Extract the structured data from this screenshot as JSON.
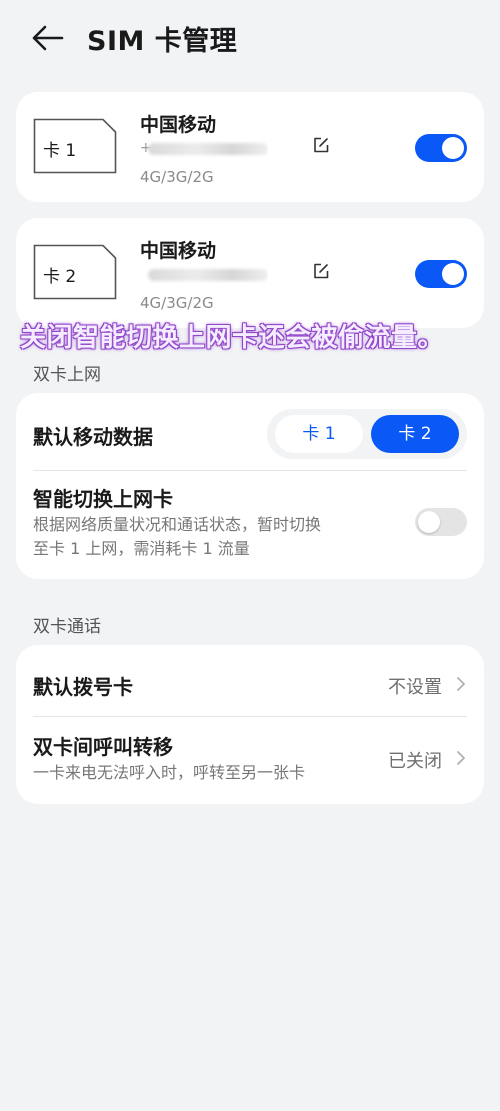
{
  "header": {
    "title": "SIM 卡管理",
    "back_icon": "back-arrow-icon"
  },
  "sim_cards": [
    {
      "label": "卡 1",
      "carrier": "中国移动",
      "number_prefix": "+",
      "network": "4G/3G/2G",
      "enabled": true
    },
    {
      "label": "卡 2",
      "carrier": "中国移动",
      "number_prefix": "",
      "network": "4G/3G/2G",
      "enabled": true
    }
  ],
  "overlay": {
    "text": "关闭智能切换上网卡还会被偷流量。"
  },
  "data_section": {
    "label": "双卡上网",
    "default_data": {
      "title": "默认移动数据",
      "options": [
        "卡 1",
        "卡 2"
      ],
      "selected": "卡 2"
    },
    "smart_switch": {
      "title": "智能切换上网卡",
      "subtitle_line1": "根据网络质量状况和通话状态，暂时切换",
      "subtitle_line2": "至卡 1 上网，需消耗卡 1 流量",
      "enabled": false
    }
  },
  "call_section": {
    "label": "双卡通话",
    "default_dial": {
      "title": "默认拨号卡",
      "value": "不设置"
    },
    "forwarding": {
      "title": "双卡间呼叫转移",
      "subtitle": "一卡来电无法呼入时，呼转至另一张卡",
      "value": "已关闭"
    }
  },
  "colors": {
    "accent": "#0a59f7",
    "background": "#f1f3f5",
    "card": "#ffffff",
    "overlay_stroke": "#9a4fd1"
  }
}
